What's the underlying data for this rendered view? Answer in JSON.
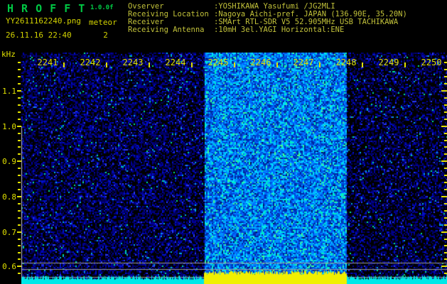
{
  "header": {
    "app_name": "H R O F F T",
    "version": "1.0.0f",
    "filename": "YY2611162240.png",
    "mode": "meteor",
    "datetime": "26.11.16 22:40",
    "count": "2",
    "info_rows": [
      {
        "label": "Ovserver",
        "value": ":YOSHIKAWA Yasufumi /JG2MLI"
      },
      {
        "label": "Receiving Location",
        "value": ":Nagoya Aichi-pref. JAPAN (136.90E, 35.20N)"
      },
      {
        "label": "Receiver",
        "value": ":SMArt RTL-SDR V5 52.905MHz USB TACHIKAWA"
      },
      {
        "label": "Receiving Antenna",
        "value": ":10mH 3el.YAGI Horizontal:ENE"
      }
    ]
  },
  "spectrogram": {
    "unit_label": "kHz",
    "time_labels": [
      "2241",
      "2242",
      "2243",
      "2244",
      "2245",
      "2246",
      "2247",
      "2248",
      "2249",
      "2250"
    ],
    "freq_labels": [
      "1.1",
      "1.0",
      "0.9",
      "0.8",
      "0.7",
      "0.6"
    ],
    "strong_signal_band": {
      "start_minute": 2244.33,
      "end_minute": 2247.67
    },
    "colors": {
      "label_yellow": "#e0e000",
      "header_green": "#00c844",
      "header_yellow": "#d2d200",
      "info_olive": "#c2c23a",
      "grid_gray": "#9a9a9a",
      "strip_quiet_cyan": "#00e8e8",
      "strip_active_yellow": "#f0f000"
    }
  }
}
